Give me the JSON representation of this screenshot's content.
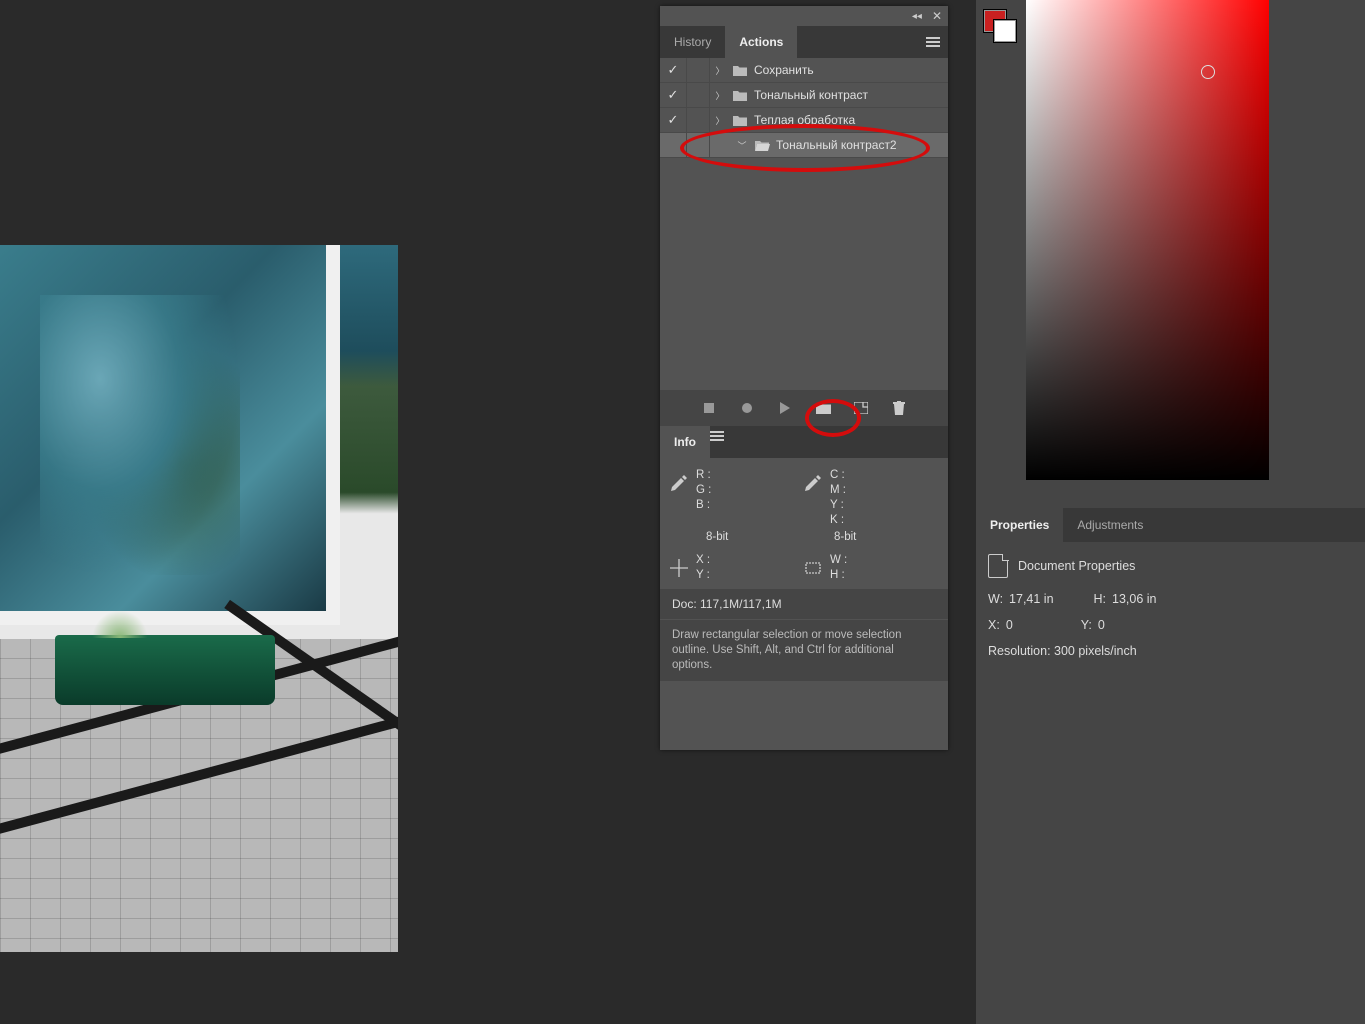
{
  "actions_panel": {
    "tab_history": "History",
    "tab_actions": "Actions",
    "rows": [
      {
        "label": "Сохранить",
        "checked": true,
        "expanded": false,
        "indent": 0,
        "selected": false
      },
      {
        "label": "Тональный контраст",
        "checked": true,
        "expanded": false,
        "indent": 0,
        "selected": false
      },
      {
        "label": "Теплая обработка",
        "checked": true,
        "expanded": false,
        "indent": 0,
        "selected": false
      },
      {
        "label": "Тональный контраст2",
        "checked": false,
        "expanded": true,
        "indent": 1,
        "selected": true
      }
    ],
    "toolbar": {
      "stop": "stop",
      "record": "record",
      "play": "play",
      "newset": "new-set",
      "new": "new",
      "trash": "trash"
    }
  },
  "info_panel": {
    "tab_info": "Info",
    "rgb": {
      "R": "R  :",
      "G": "G  :",
      "B": "B  :"
    },
    "cmyk": {
      "C": "C  :",
      "M": "M  :",
      "Y": "Y  :",
      "K": "K  :"
    },
    "bit_left": "8-bit",
    "bit_right": "8-bit",
    "xy": {
      "X": "X  :",
      "Y": "Y  :"
    },
    "wh": {
      "W": "W  :",
      "H": "H  :"
    },
    "doc": "Doc: 117,1M/117,1M",
    "hint": "Draw rectangular selection or move selection outline.  Use Shift, Alt, and Ctrl for additional options."
  },
  "properties_panel": {
    "tab_properties": "Properties",
    "tab_adjustments": "Adjustments",
    "title": "Document Properties",
    "W_label": "W:",
    "W_val": "17,41 in",
    "H_label": "H:",
    "H_val": "13,06 in",
    "X_label": "X:",
    "X_val": "0",
    "Y_label": "Y:",
    "Y_val": "0",
    "resolution": "Resolution: 300 pixels/inch"
  },
  "colors": {
    "foreground": "#c92020",
    "background": "#ffffff"
  }
}
